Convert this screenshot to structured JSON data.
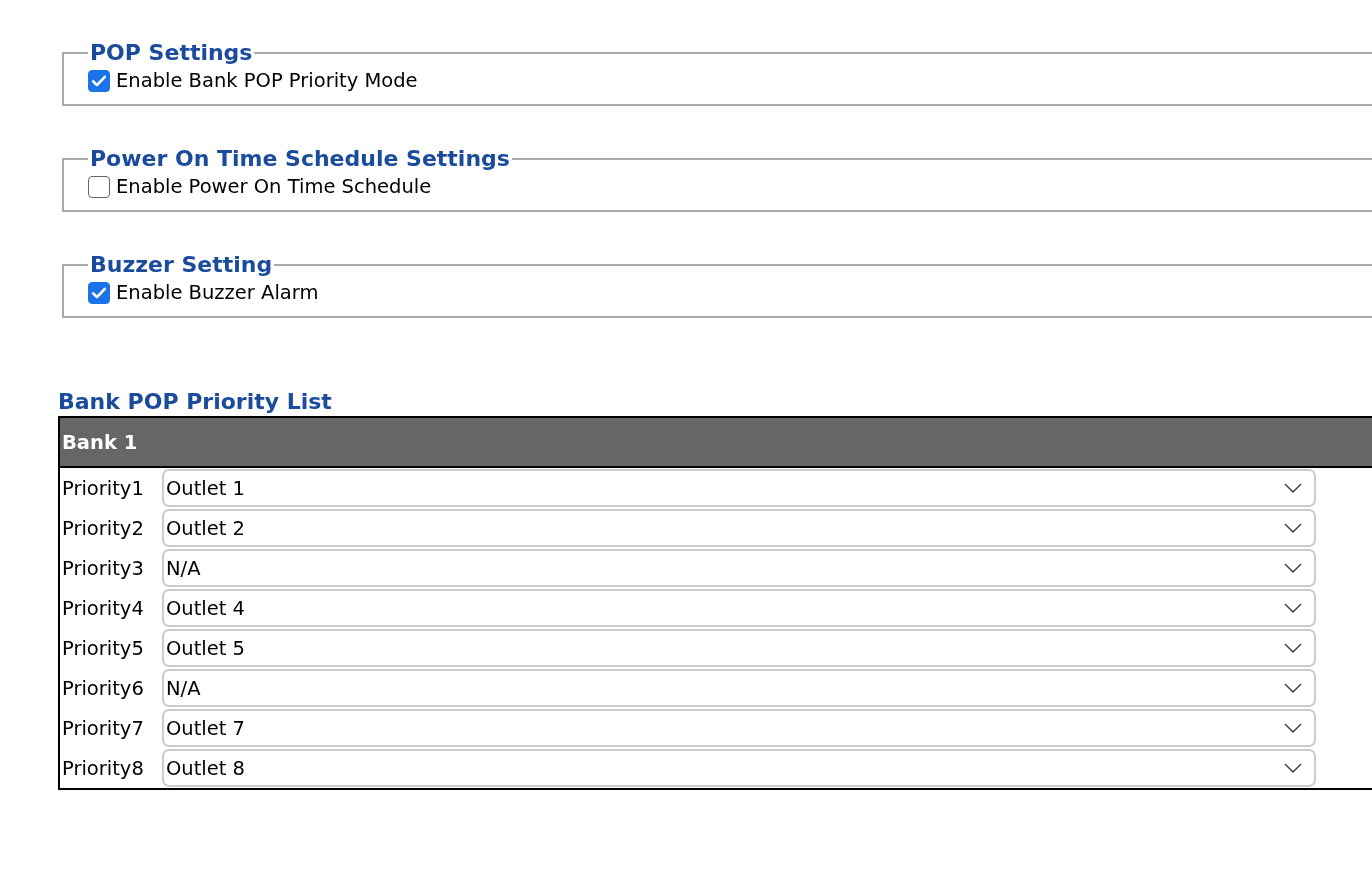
{
  "sections": [
    {
      "legend": "POP Settings",
      "option": {
        "label": "Enable Bank POP Priority Mode",
        "checked": true
      }
    },
    {
      "legend": "Power On Time Schedule Settings",
      "option": {
        "label": "Enable Power On Time Schedule",
        "checked": false
      }
    },
    {
      "legend": "Buzzer Setting",
      "option": {
        "label": "Enable Buzzer Alarm",
        "checked": true
      }
    }
  ],
  "priority_list": {
    "title": "Bank POP Priority List",
    "bank": "Bank 1",
    "rows": [
      {
        "label": "Priority1",
        "value": "Outlet 1"
      },
      {
        "label": "Priority2",
        "value": "Outlet 2"
      },
      {
        "label": "Priority3",
        "value": "N/A"
      },
      {
        "label": "Priority4",
        "value": "Outlet 4"
      },
      {
        "label": "Priority5",
        "value": "Outlet 5"
      },
      {
        "label": "Priority6",
        "value": "N/A"
      },
      {
        "label": "Priority7",
        "value": "Outlet 7"
      },
      {
        "label": "Priority8",
        "value": "Outlet 8"
      }
    ]
  }
}
